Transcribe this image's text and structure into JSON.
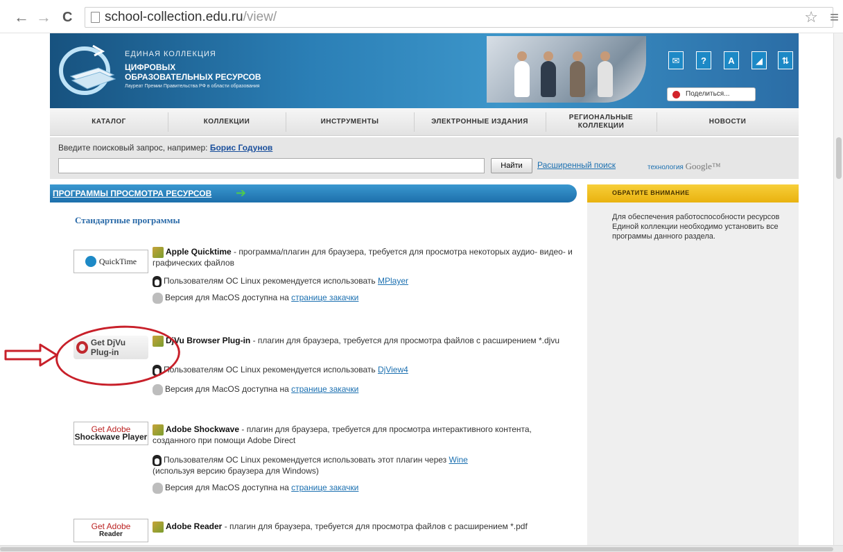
{
  "browser": {
    "url_host": "school-collection.edu.ru",
    "url_path": "/view/",
    "back_icon": "←",
    "forward_icon": "→",
    "reload_icon": "C",
    "star_icon": "☆",
    "menu_icon": "≡"
  },
  "header": {
    "line1": "ЕДИНАЯ КОЛЛЕКЦИЯ",
    "line2": "ЦИФРОВЫХ",
    "line3": "ОБРАЗОВАТЕЛЬНЫХ РЕСУРСОВ",
    "line4": "Лауреат Премии Правительства РФ в области образования",
    "tool_labels": [
      "✉",
      "?",
      "A",
      "◢",
      "⇅"
    ],
    "share_label": "Поделиться..."
  },
  "nav": {
    "items": [
      "КАТАЛОГ",
      "КОЛЛЕКЦИИ",
      "ИНСТРУМЕНТЫ",
      "ЭЛЕКТРОННЫЕ ИЗДАНИЯ",
      "РЕГИОНАЛЬНЫЕ КОЛЛЕКЦИИ",
      "НОВОСТИ"
    ]
  },
  "search": {
    "hint": "Введите поисковый запрос, например:",
    "example": "Борис Годунов",
    "value": "",
    "find_label": "Найти",
    "advanced_label": "Расширенный поиск",
    "google_prefix": "технология",
    "google_word": "Google™"
  },
  "section": {
    "title": "ПРОГРАММЫ ПРОСМОТРА РЕСУРСОВ",
    "arrow": "➔",
    "subtitle": "Стандартные программы"
  },
  "programs": [
    {
      "logo_text": "QuickTime",
      "name": "Apple Quicktime",
      "desc": " - программа/плагин для браузера, требуется для просмотра некоторых аудио- видео- и графических файлов",
      "linux_text": "Пользователям ОС Linux рекомендуется использовать ",
      "linux_link": "MPlayer",
      "linux_extra": "",
      "mac_text": "Версия для MacOS доступна на ",
      "mac_link": "странице закачки"
    },
    {
      "logo_text": "Get DjVu Plug-in",
      "name": "DjVu Browser Plug-in",
      "desc": " - плагин для браузера, требуется для просмотра файлов с расширением *.djvu",
      "linux_text": "Пользователям ОС Linux рекомендуется использовать ",
      "linux_link": "DjView4",
      "linux_extra": "",
      "mac_text": "Версия для MacOS доступна на ",
      "mac_link": "странице закачки"
    },
    {
      "logo_text": "Get Adobe",
      "logo_sub": "Shockwave Player",
      "name": "Adobe Shockwave",
      "desc": " - плагин для браузера, требуется для просмотра интерактивного контента, созданного при помощи Adobe Direct",
      "linux_text": "Пользователям ОС Linux рекомендуется использовать этот плагин через ",
      "linux_link": "Wine",
      "linux_extra": "(используя версию браузера для Windows)",
      "mac_text": "Версия для MacOS доступна на ",
      "mac_link": "странице закачки"
    },
    {
      "logo_text": "Get Adobe",
      "logo_sub": "Reader",
      "name": "Adobe Reader",
      "desc": " - плагин для браузера, требуется для просмотра файлов с расширением *.pdf"
    }
  ],
  "notice": {
    "title": "ОБРАТИТЕ ВНИМАНИЕ",
    "text": "Для обеспечения работоспособности ресурсов Единой коллекции необходимо установить все программы данного раздела."
  },
  "colors": {
    "header_blue": "#2b7fb6",
    "accent_yellow": "#e9b20f",
    "annotation_red": "#c8202a",
    "link_blue": "#1a6fb0"
  }
}
